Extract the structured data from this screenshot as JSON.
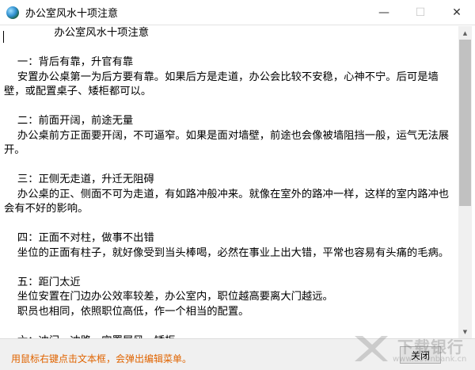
{
  "window": {
    "title": "办公室风水十项注意",
    "controls": {
      "minimize_icon": "minimize-icon",
      "maximize_icon": "maximize-icon",
      "close_icon": "close-icon"
    }
  },
  "content": {
    "lines": [
      "               办公室风水十项注意",
      "",
      "    一：背后有靠，升官有靠",
      "    安置办公桌第一为后方要有靠。如果后方是走道，办公会比较不安稳，心神不宁。后可是墙壁，或配置桌子、矮柜都可以。",
      "",
      "    二：前面开阔，前途无量",
      "    办公桌前方正面要开阔，不可逼窄。如果是面对墙壁，前途也会像被墙阻挡一般，运气无法展开。",
      "",
      "    三：正侧无走道，升迁无阻碍",
      "    办公桌的正、侧面不可为走道，有如路冲般冲来。就像在室外的路冲一样，这样的室内路冲也会有不好的影响。",
      "",
      "    四：正面不对柱，做事不出错",
      "    坐位的正面有柱子，就好像受到当头棒喝，必然在事业上出大错，平常也容易有头痛的毛病。",
      "",
      "    五：距门太近",
      "    坐位安置在门边办公效率较差，办公室内，职位越高要离大门越远。",
      "    职员也相同，依照职位高低，作一个相当的配置。",
      "",
      "    六：冲门、冲路、宜置屏风、矮柜"
    ]
  },
  "footer": {
    "hint": "用鼠标右键点击文本框，会弹出编辑菜单。",
    "close_label": "关闭"
  },
  "watermark": {
    "text": "下载银行",
    "url": "www.downbank.cn"
  }
}
